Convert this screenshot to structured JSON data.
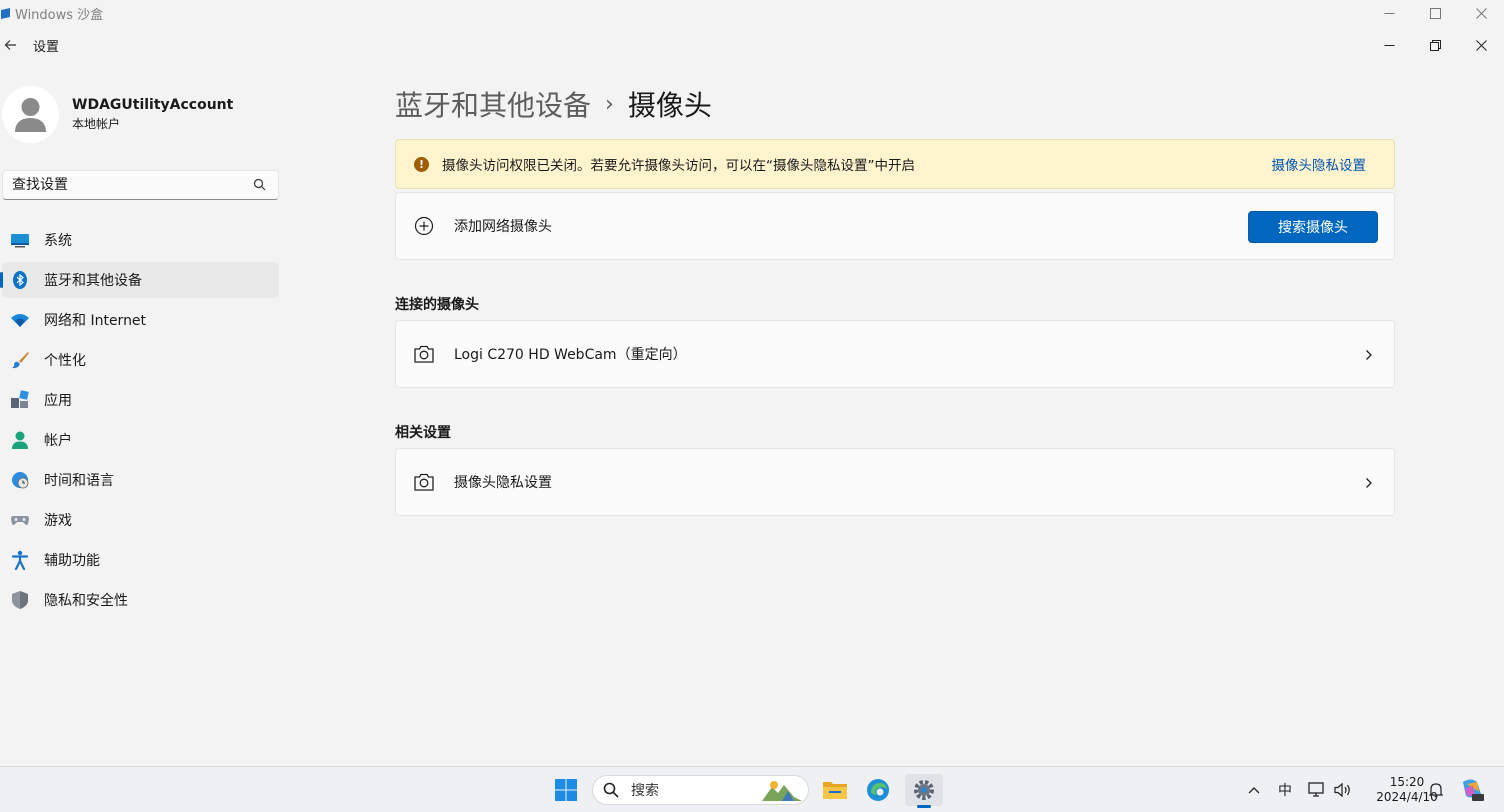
{
  "sandbox": {
    "title": "Windows 沙盒"
  },
  "app": {
    "title": "设置"
  },
  "profile": {
    "name": "WDAGUtilityAccount",
    "type": "本地帐户"
  },
  "search": {
    "placeholder": "查找设置"
  },
  "nav": {
    "items": [
      {
        "label": "系统",
        "icon": "system-icon"
      },
      {
        "label": "蓝牙和其他设备",
        "icon": "bluetooth-icon",
        "active": true
      },
      {
        "label": "网络和 Internet",
        "icon": "wifi-icon"
      },
      {
        "label": "个性化",
        "icon": "brush-icon"
      },
      {
        "label": "应用",
        "icon": "apps-icon"
      },
      {
        "label": "帐户",
        "icon": "account-icon"
      },
      {
        "label": "时间和语言",
        "icon": "globe-clock-icon"
      },
      {
        "label": "游戏",
        "icon": "gamepad-icon"
      },
      {
        "label": "辅助功能",
        "icon": "accessibility-icon"
      },
      {
        "label": "隐私和安全性",
        "icon": "shield-icon"
      }
    ]
  },
  "breadcrumb": {
    "parent": "蓝牙和其他设备",
    "separator": "›",
    "current": "摄像头"
  },
  "warning": {
    "text": "摄像头访问权限已关闭。若要允许摄像头访问，可以在“摄像头隐私设置”中开启",
    "link": "摄像头隐私设置"
  },
  "add_camera": {
    "label": "添加网络摄像头",
    "button": "搜索摄像头"
  },
  "connected": {
    "title": "连接的摄像头",
    "items": [
      {
        "label": "Logi C270 HD WebCam（重定向）"
      }
    ]
  },
  "related": {
    "title": "相关设置",
    "items": [
      {
        "label": "摄像头隐私设置"
      }
    ]
  },
  "taskbar": {
    "search_label": "搜索",
    "ime": "中",
    "time": "15:20",
    "date": "2024/4/10"
  },
  "colors": {
    "accent": "#0067c0",
    "warning_bg": "#fff4ce",
    "warning_icon": "#9d5d00"
  }
}
